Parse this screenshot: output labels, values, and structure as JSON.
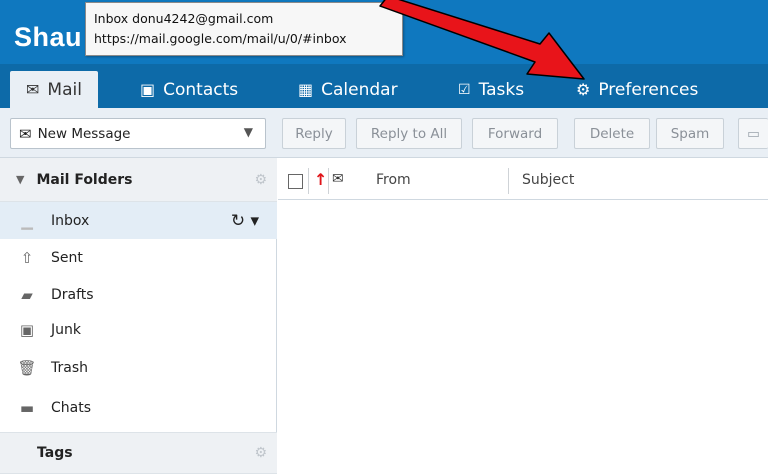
{
  "app": {
    "logo_text": "Shau"
  },
  "tooltip": {
    "line1": "Inbox donu4242@gmail.com",
    "line2": "https://mail.google.com/mail/u/0/#inbox"
  },
  "nav": {
    "tabs": [
      {
        "label": "Mail",
        "icon": "envelope-icon"
      },
      {
        "label": "Contacts",
        "icon": "contact-card-icon"
      },
      {
        "label": "Calendar",
        "icon": "calendar-icon"
      },
      {
        "label": "Tasks",
        "icon": "checkbox-icon"
      },
      {
        "label": "Preferences",
        "icon": "gear-icon"
      }
    ],
    "active": "Mail"
  },
  "toolbar": {
    "new_message": "New Message",
    "reply": "Reply",
    "reply_all": "Reply to All",
    "forward": "Forward",
    "delete": "Delete",
    "spam": "Spam"
  },
  "sidebar": {
    "folders_title": "Mail Folders",
    "folders": [
      {
        "label": "Inbox",
        "icon": "inbox-tray-icon"
      },
      {
        "label": "Sent",
        "icon": "sent-upload-icon"
      },
      {
        "label": "Drafts",
        "icon": "drafts-folder-icon"
      },
      {
        "label": "Junk",
        "icon": "junk-folder-icon"
      },
      {
        "label": "Trash",
        "icon": "trash-icon"
      },
      {
        "label": "Chats",
        "icon": "folder-icon"
      }
    ],
    "tags_title": "Tags"
  },
  "list": {
    "col_from": "From",
    "col_subject": "Subject"
  },
  "colors": {
    "banner": "#0f78bf",
    "nav": "#0d6aa8",
    "toolbar_bg": "#e9eff5",
    "selected_row": "#e3edf6",
    "annotation_arrow": "#e8141a"
  }
}
